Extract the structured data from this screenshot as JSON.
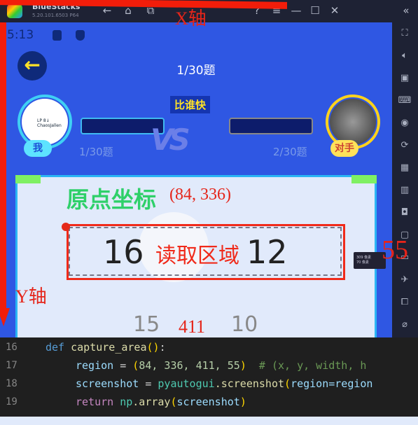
{
  "titlebar": {
    "app_name": "BlueStacks",
    "version": "5.20.101.6503  P64",
    "icons": [
      "back-icon",
      "home-icon",
      "multi-instance-icon",
      "help-icon",
      "menu-icon",
      "minimize-icon",
      "maximize-icon",
      "close-icon",
      "collapse-sidebar-icon"
    ]
  },
  "status": {
    "time": "5:13"
  },
  "game": {
    "question_counter": "1/30题",
    "race_label": "比谁快",
    "vs": "VS",
    "me": {
      "tag": "我",
      "name": "ChaosJallen",
      "level": "LP 8↓",
      "progress": "1/30题"
    },
    "opponent": {
      "tag": "对手",
      "progress": "2/30题"
    },
    "numbers_top": [
      "16",
      "12"
    ],
    "numbers_bottom": [
      "15",
      "?",
      "10"
    ],
    "tooltip": [
      "309 像素",
      "70 像素"
    ]
  },
  "annotations": {
    "x_axis": "X轴",
    "y_axis": "Y轴",
    "origin_label": "原点坐标",
    "origin_coord": "(84, 336)",
    "region_label": "读取区域",
    "height": "55",
    "width": "411"
  },
  "code": {
    "lines": [
      {
        "n": "16"
      },
      {
        "n": "17"
      },
      {
        "n": "18"
      },
      {
        "n": "19"
      }
    ],
    "l16": {
      "kw": "def",
      "fn": "capture_area",
      "p1": "(",
      "p2": ")",
      "end": ":"
    },
    "l17": {
      "var": "region",
      "eq": " = ",
      "p1": "(",
      "nums": "84, 336, 411, 55",
      "p2": ")",
      "cm": "  # (x, y, width, h"
    },
    "l18": {
      "var": "screenshot",
      "eq": " = ",
      "mod": "pyautogui",
      "fn": ".screenshot",
      "p1": "(",
      "arg": "region=region"
    },
    "l19": {
      "kw": "return",
      "mod": "np",
      "fn": ".array",
      "p1": "(",
      "arg": "screenshot",
      "p2": ")"
    }
  },
  "colors": {
    "android_bg": "#2f57e3",
    "annotation_red": "#f02a1a",
    "origin_green": "#2fd06a",
    "code_bg": "#1f1f1f"
  }
}
